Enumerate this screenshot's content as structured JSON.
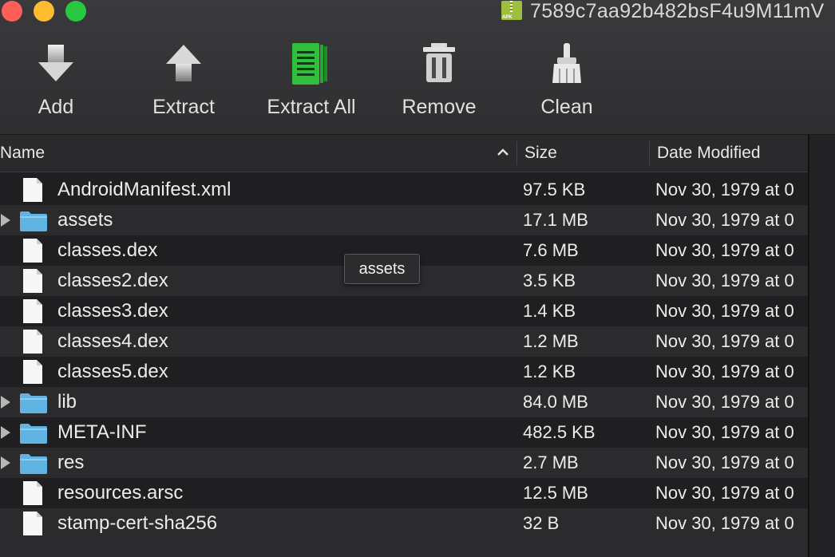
{
  "window": {
    "title": "7589c7aa92b482bsF4u9M11mV"
  },
  "toolbar": {
    "add_label": "Add",
    "extract_label": "Extract",
    "extract_all_label": "Extract All",
    "remove_label": "Remove",
    "clean_label": "Clean"
  },
  "columns": {
    "name": "Name",
    "size": "Size",
    "date": "Date Modified",
    "sort_order": "ascending"
  },
  "files": [
    {
      "name": "AndroidManifest.xml",
      "size": "97.5 KB",
      "date": "Nov 30, 1979 at 0",
      "type": "file"
    },
    {
      "name": "assets",
      "size": "17.1 MB",
      "date": "Nov 30, 1979 at 0",
      "type": "folder"
    },
    {
      "name": "classes.dex",
      "size": "7.6 MB",
      "date": "Nov 30, 1979 at 0",
      "type": "file"
    },
    {
      "name": "classes2.dex",
      "size": "3.5 KB",
      "date": "Nov 30, 1979 at 0",
      "type": "file"
    },
    {
      "name": "classes3.dex",
      "size": "1.4 KB",
      "date": "Nov 30, 1979 at 0",
      "type": "file"
    },
    {
      "name": "classes4.dex",
      "size": "1.2 MB",
      "date": "Nov 30, 1979 at 0",
      "type": "file"
    },
    {
      "name": "classes5.dex",
      "size": "1.2 KB",
      "date": "Nov 30, 1979 at 0",
      "type": "file"
    },
    {
      "name": "lib",
      "size": "84.0 MB",
      "date": "Nov 30, 1979 at 0",
      "type": "folder"
    },
    {
      "name": "META-INF",
      "size": "482.5 KB",
      "date": "Nov 30, 1979 at 0",
      "type": "folder"
    },
    {
      "name": "res",
      "size": "2.7 MB",
      "date": "Nov 30, 1979 at 0",
      "type": "folder"
    },
    {
      "name": "resources.arsc",
      "size": "12.5 MB",
      "date": "Nov 30, 1979 at 0",
      "type": "file"
    },
    {
      "name": "stamp-cert-sha256",
      "size": "32 B",
      "date": "Nov 30, 1979 at 0",
      "type": "file"
    }
  ],
  "tooltip": {
    "text": "assets"
  },
  "colors": {
    "folder": "#5fb4e4",
    "extract_all_icon": "#2fbf3a",
    "row_alt": "#2b2b2e",
    "row_base": "#1f1f22"
  }
}
